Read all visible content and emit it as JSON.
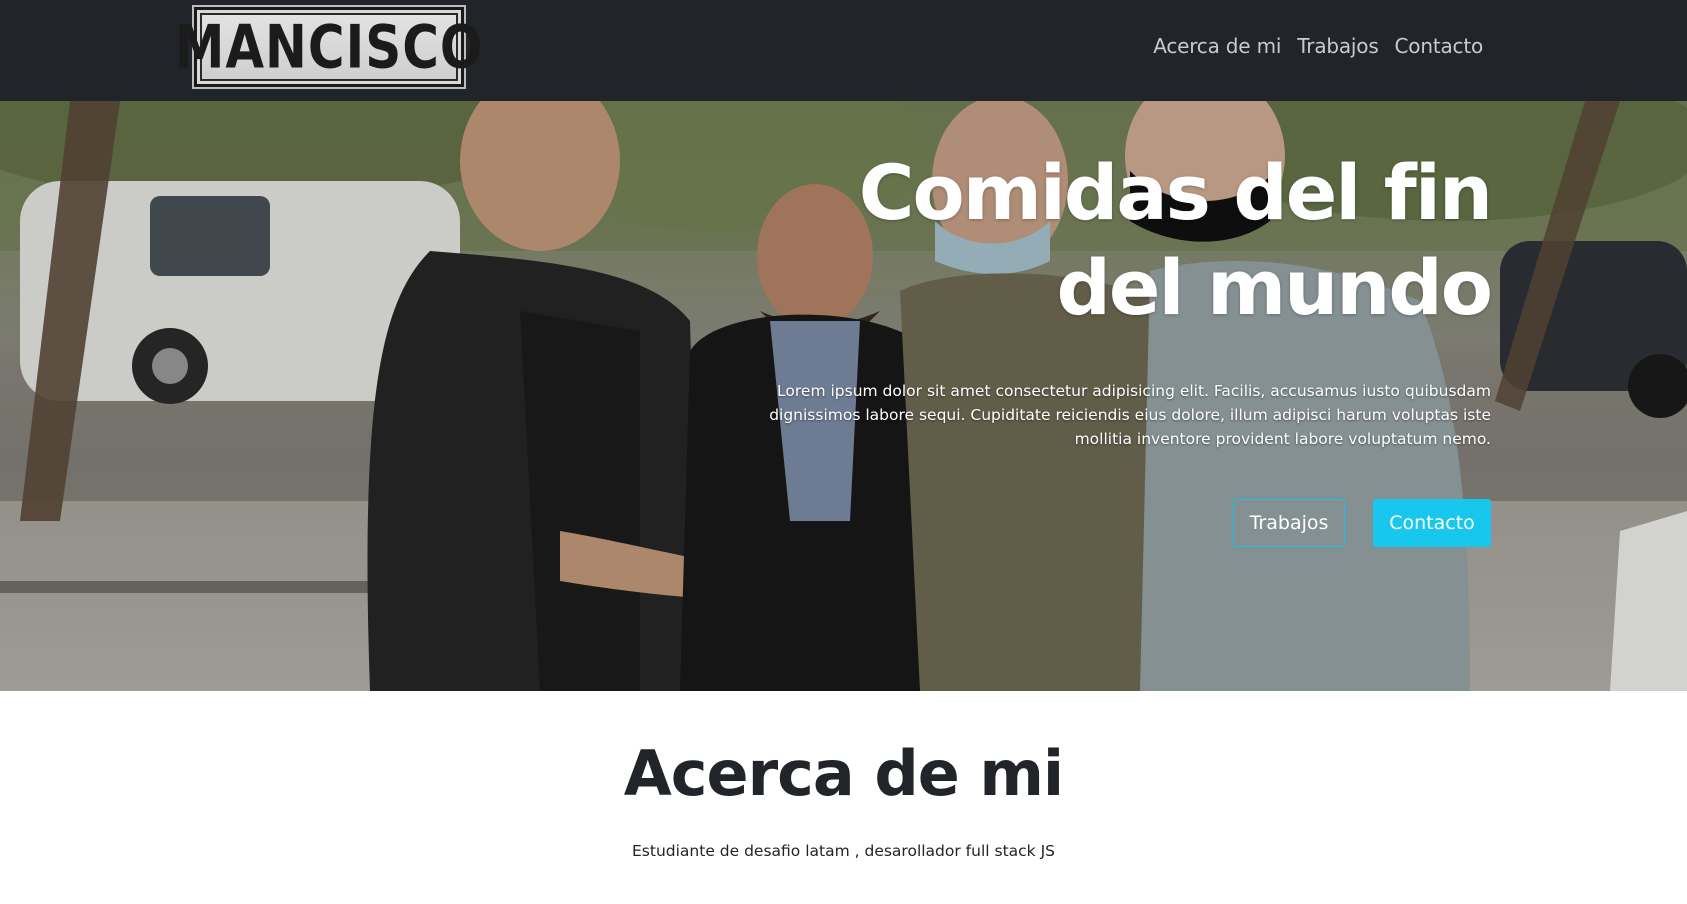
{
  "navbar": {
    "logo_text": "MANCISCO",
    "links": [
      "Acerca de mi",
      "Trabajos",
      "Contacto"
    ]
  },
  "hero": {
    "title_line1": "Comidas del fin",
    "title_line2": "del mundo",
    "text": "Lorem ipsum dolor sit amet consectetur adipisicing elit. Facilis, accusamus iusto quibusdam dignissimos labore sequi. Cupiditate reiciendis eius dolore, illum adipisci harum voluptas iste mollitia inventore provident labore voluptatum nemo.",
    "button_primary": "Trabajos",
    "button_secondary": "Contacto"
  },
  "about": {
    "title": "Acerca de mi",
    "text": "Estudiante de desafio latam , desarollador full stack JS"
  },
  "colors": {
    "navbar_bg": "#212529",
    "accent": "#17c7ed",
    "text_dark": "#212529"
  }
}
